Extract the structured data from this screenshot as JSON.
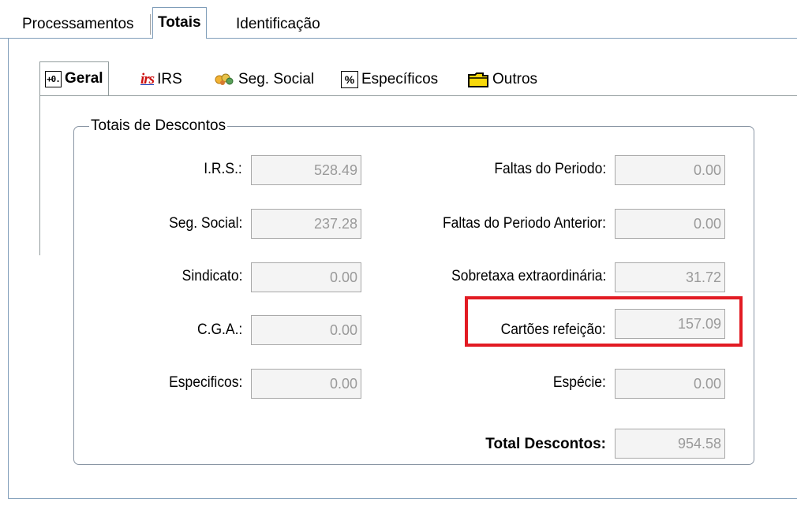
{
  "top_tabs": [
    {
      "label": "Processamentos",
      "active": false
    },
    {
      "label": "Totais",
      "active": true
    },
    {
      "label": "Identificação",
      "active": false
    }
  ],
  "inner_tabs": [
    {
      "label": "Geral",
      "icon": "geral-icon",
      "icon_text": "+0.",
      "active": true
    },
    {
      "label": "IRS",
      "icon": "irs-logo-icon",
      "icon_text": "irs",
      "active": false
    },
    {
      "label": "Seg. Social",
      "icon": "seg-social-icon",
      "active": false
    },
    {
      "label": "Específicos",
      "icon": "percent-icon",
      "icon_text": "%",
      "active": false
    },
    {
      "label": "Outros",
      "icon": "folder-icon",
      "active": false
    }
  ],
  "group": {
    "title": "Totais de Descontos"
  },
  "fields": {
    "irs": {
      "label": "I.R.S.:",
      "value": "528.49"
    },
    "seg_social": {
      "label": "Seg. Social:",
      "value": "237.28"
    },
    "sindicato": {
      "label": "Sindicato:",
      "value": "0.00"
    },
    "cga": {
      "label": "C.G.A.:",
      "value": "0.00"
    },
    "especificos": {
      "label": "Especificos:",
      "value": "0.00"
    },
    "faltas_periodo": {
      "label": "Faltas do Periodo:",
      "value": "0.00"
    },
    "faltas_periodo_anterior": {
      "label": "Faltas do Periodo Anterior:",
      "value": "0.00"
    },
    "sobretaxa": {
      "label": "Sobretaxa extraordinária:",
      "value": "31.72"
    },
    "cartoes_refeicao": {
      "label": "Cartões refeição:",
      "value": "157.09"
    },
    "especie": {
      "label": "Espécie:",
      "value": "0.00"
    },
    "total_descontos": {
      "label": "Total Descontos:",
      "value": "954.58"
    }
  },
  "colors": {
    "highlight": "#e21b23",
    "tab_border": "#7f9db9",
    "field_text": "#9a9a9a"
  }
}
